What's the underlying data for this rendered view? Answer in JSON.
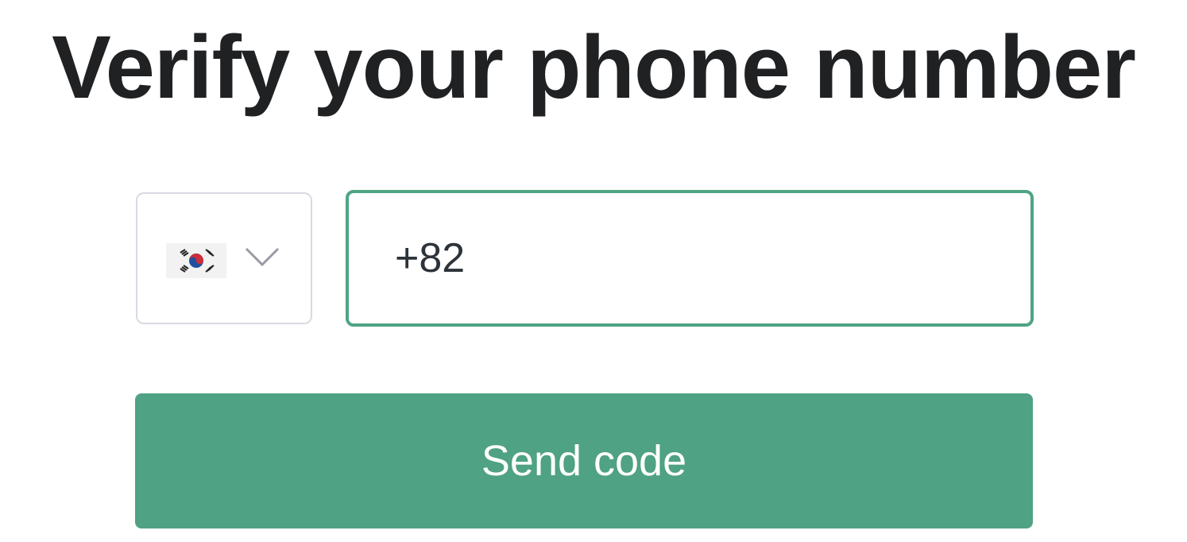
{
  "header": {
    "title": "Verify your phone number"
  },
  "form": {
    "country_select": {
      "selected_flag": "south-korea-flag-icon",
      "dropdown_icon": "chevron-down-icon"
    },
    "phone_input": {
      "value": "+82"
    },
    "send_button": {
      "label": "Send code"
    }
  },
  "colors": {
    "accent": "#4fa283",
    "focus_border": "#4fa483",
    "title_text": "#202123",
    "border_neutral": "#d9d9e3"
  }
}
